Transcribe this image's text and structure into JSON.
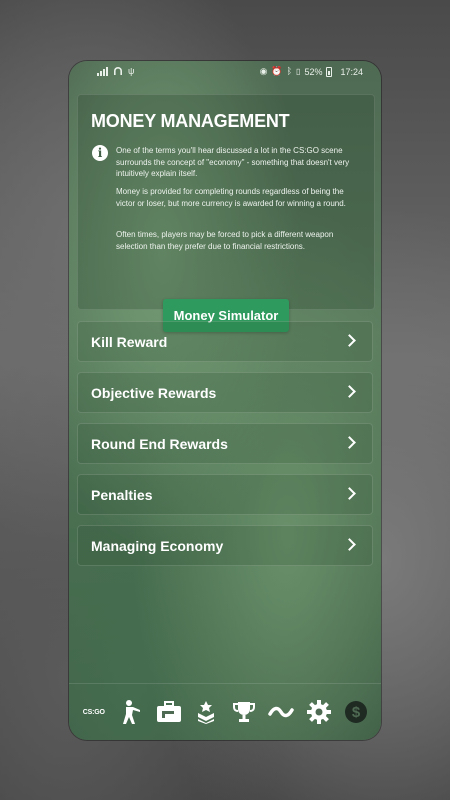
{
  "status_bar": {
    "battery": "52%",
    "time": "17:24"
  },
  "header": {
    "title": "MONEY MANAGEMENT"
  },
  "info": {
    "paragraphs": [
      "One of the terms you'll hear discussed a lot in the CS:GO scene surrounds the concept of \"economy\" - something that doesn't very intuitively explain itself.",
      "Money is provided for completing rounds regardless of being the victor or loser, but more currency is awarded for winning a round.",
      "Often times, players may be forced to pick a different weapon selection than they prefer due to financial restrictions."
    ]
  },
  "simulator_button": "Money Simulator",
  "menu": [
    {
      "label": "Kill Reward"
    },
    {
      "label": "Objective Rewards"
    },
    {
      "label": "Round End Rewards"
    },
    {
      "label": "Penalties"
    },
    {
      "label": "Managing Economy"
    }
  ],
  "tabbar": {
    "items": [
      {
        "icon": "csgo-logo-icon",
        "label": "CS:GO"
      },
      {
        "icon": "soldier-icon"
      },
      {
        "icon": "briefcase-gun-icon"
      },
      {
        "icon": "rank-chevron-icon"
      },
      {
        "icon": "trophy-icon"
      },
      {
        "icon": "wave-icon"
      },
      {
        "icon": "gear-icon"
      },
      {
        "icon": "dollar-icon"
      }
    ]
  }
}
